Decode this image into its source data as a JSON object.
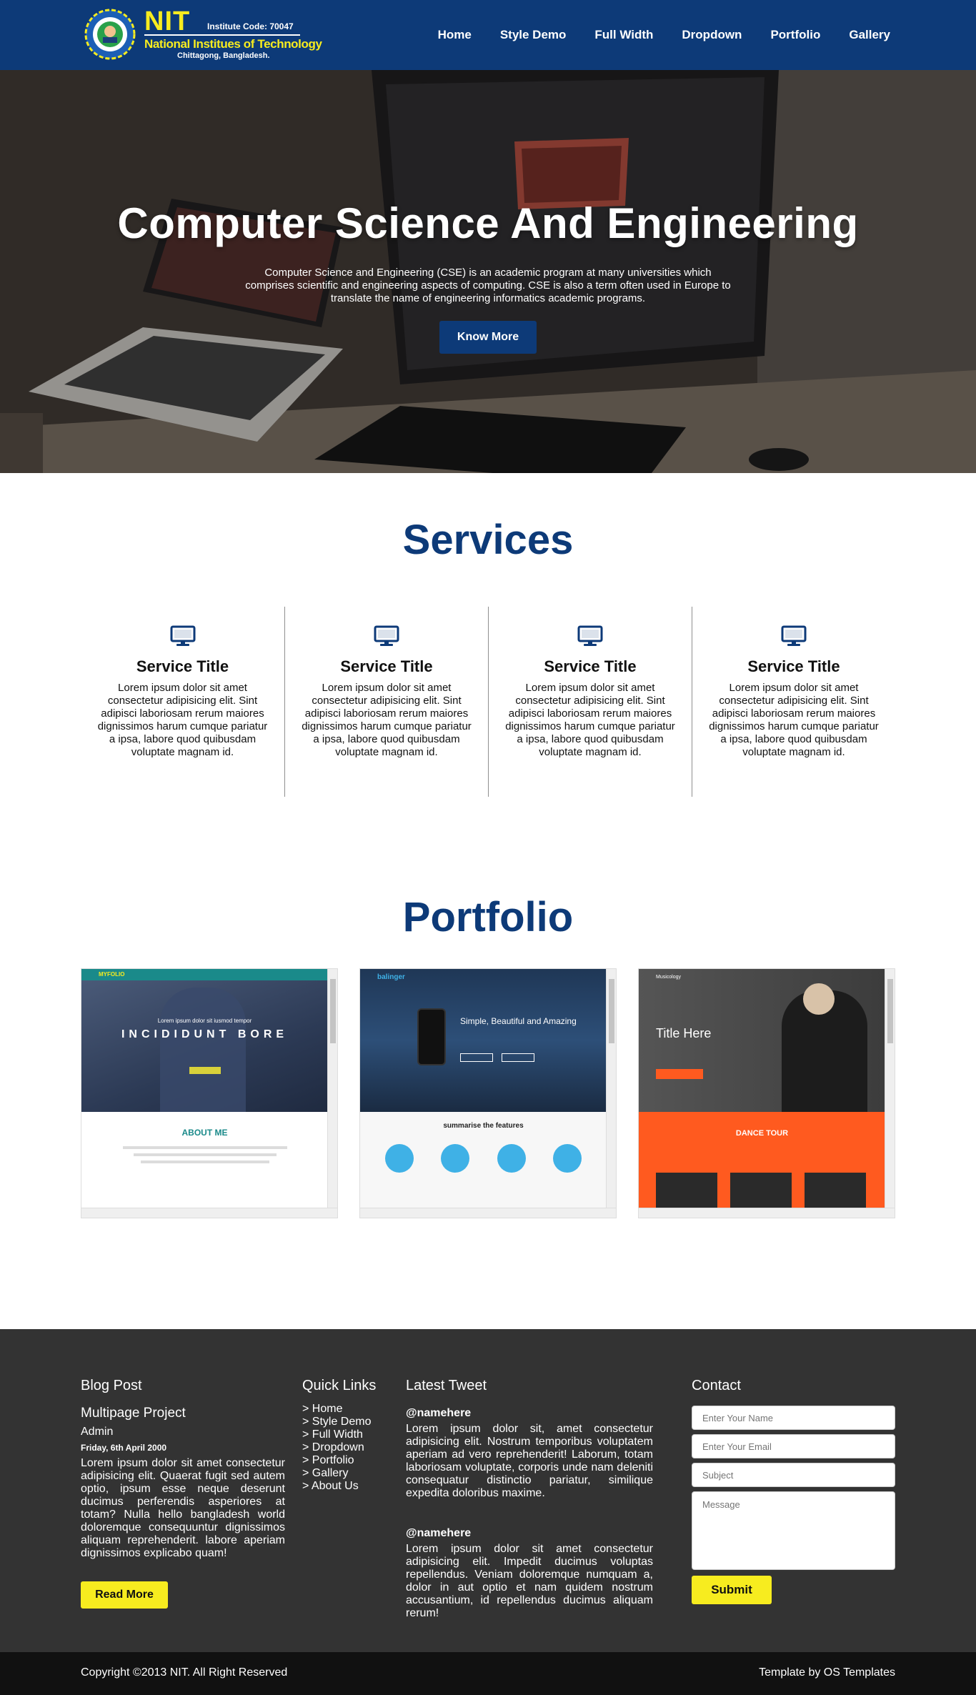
{
  "header": {
    "logo_title": "NIT",
    "institute_code": "Institute Code: 70047",
    "institute_name": "National Institues of Technology",
    "location": "Chittagong, Bangladesh.",
    "nav": [
      "Home",
      "Style Demo",
      "Full Width",
      "Dropdown",
      "Portfolio",
      "Gallery"
    ],
    "bg_color": "#0d3a78",
    "logo_color": "#f7ec1f"
  },
  "hero": {
    "title": "Computer Science And Engineering",
    "text": "Computer Science and Engineering (CSE) is an academic program at many universities which comprises scientific and engineering aspects of computing. CSE is also a term often used in Europe to translate the name of engineering informatics academic programs.",
    "button": "Know More"
  },
  "services": {
    "title": "Services",
    "items": [
      {
        "title": "Service Title",
        "text": "Lorem ipsum dolor sit amet consectetur adipisicing elit. Sint adipisci laboriosam rerum maiores dignissimos harum cumque pariatur a ipsa, labore quod quibusdam voluptate magnam id.",
        "icon": "monitor-icon"
      },
      {
        "title": "Service Title",
        "text": "Lorem ipsum dolor sit amet consectetur adipisicing elit. Sint adipisci laboriosam rerum maiores dignissimos harum cumque pariatur a ipsa, labore quod quibusdam voluptate magnam id.",
        "icon": "monitor-icon"
      },
      {
        "title": "Service Title",
        "text": "Lorem ipsum dolor sit amet consectetur adipisicing elit. Sint adipisci laboriosam rerum maiores dignissimos harum cumque pariatur a ipsa, labore quod quibusdam voluptate magnam id.",
        "icon": "monitor-icon"
      },
      {
        "title": "Service Title",
        "text": "Lorem ipsum dolor sit amet consectetur adipisicing elit. Sint adipisci laboriosam rerum maiores dignissimos harum cumque pariatur a ipsa, labore quod quibusdam voluptate magnam id.",
        "icon": "monitor-icon"
      }
    ]
  },
  "portfolio": {
    "title": "Portfolio",
    "items": [
      {
        "brand": "MYFOLIO",
        "tagline": "Lorem ipsum dolor sit iusmod tempor",
        "headline": "INCIDIDUNT BORE",
        "section": "ABOUT ME"
      },
      {
        "brand": "balinger",
        "headline": "Simple, Beautiful and Amazing",
        "section": "summarise the features"
      },
      {
        "brand": "Musicology",
        "headline": "Title Here",
        "section": "DANCE TOUR"
      }
    ]
  },
  "footer": {
    "blog": {
      "heading": "Blog Post",
      "title": "Multipage Project",
      "author": "Admin",
      "date": "Friday, 6th April 2000",
      "text": "Lorem ipsum dolor sit amet consectetur adipisicing elit. Quaerat fugit sed autem optio, ipsum esse neque deserunt ducimus perferendis asperiores at totam? Nulla hello bangladesh world doloremque consequuntur dignissimos aliquam reprehenderit. labore aperiam dignissimos explicabo quam!",
      "button": "Read More"
    },
    "links": {
      "heading": "Quick Links",
      "items": [
        "> Home",
        "> Style Demo",
        "> Full Width",
        "> Dropdown",
        "> Portfolio",
        "> Gallery",
        "> About Us"
      ]
    },
    "tweets": {
      "heading": "Latest Tweet",
      "items": [
        {
          "handle": "@namehere",
          "text": "Lorem ipsum dolor sit, amet consectetur adipisicing elit. Nostrum temporibus voluptatem aperiam ad vero reprehenderit! Laborum, totam laboriosam voluptate, corporis unde nam deleniti consequatur distinctio pariatur, similique expedita doloribus maxime."
        },
        {
          "handle": "@namehere",
          "text": "Lorem ipsum dolor sit amet consectetur adipisicing elit. Impedit ducimus voluptas repellendus. Veniam doloremque numquam a, dolor in aut optio et nam quidem nostrum accusantium, id repellendus ducimus aliquam rerum!"
        }
      ]
    },
    "contact": {
      "heading": "Contact",
      "name_placeholder": "Enter Your Name",
      "email_placeholder": "Enter Your Email",
      "subject_placeholder": "Subject",
      "message_placeholder": "Message",
      "button": "Submit"
    },
    "copyright": "Copyright ©2013 NIT. All Right Reserved",
    "credit": "Template by OS Templates"
  }
}
